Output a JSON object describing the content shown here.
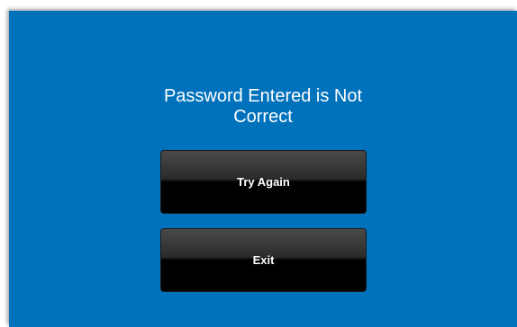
{
  "dialog": {
    "message_line1": "Password Entered is Not",
    "message_line2": "Correct",
    "colors": {
      "background": "#0071bb",
      "button": "#000000",
      "text": "#ffffff"
    }
  },
  "buttons": {
    "try_again_label": "Try Again",
    "exit_label": "Exit"
  }
}
